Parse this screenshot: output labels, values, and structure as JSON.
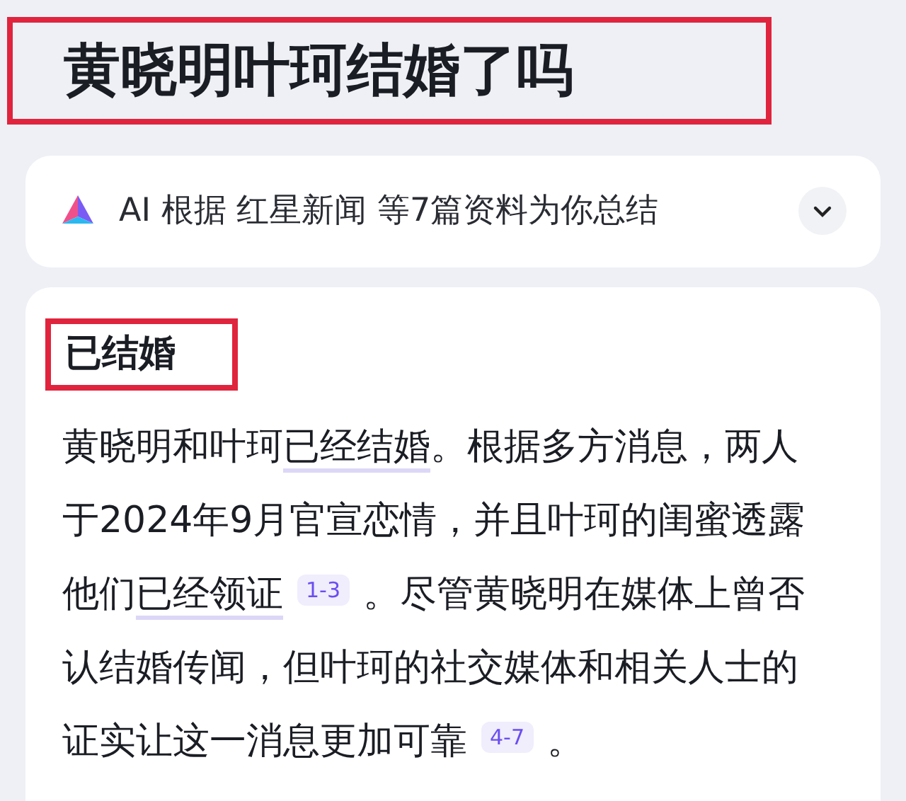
{
  "query_title": "黄晓明叶珂结婚了吗",
  "ai_summary": {
    "label": "AI 根据 红星新闻 等7篇资料为你总结",
    "expanded": false
  },
  "answer": {
    "heading": "已结婚",
    "parts": [
      {
        "kind": "text",
        "text": "黄晓明和叶珂"
      },
      {
        "kind": "underlined",
        "text": "已经结婚"
      },
      {
        "kind": "text",
        "text": "。根据多方消息，两人于2024年9月官宣恋情，并且叶珂的闺蜜透露他们"
      },
      {
        "kind": "underlined",
        "text": "已经领证"
      },
      {
        "kind": "citation",
        "text": "1-3"
      },
      {
        "kind": "text",
        "text": "。尽管黄晓明在媒体上曾否认结婚传闻，但叶珂的社交媒体和相关人士的证实让这一消息更加可靠"
      },
      {
        "kind": "citation",
        "text": "4-7"
      },
      {
        "kind": "text",
        "text": "。"
      }
    ]
  }
}
